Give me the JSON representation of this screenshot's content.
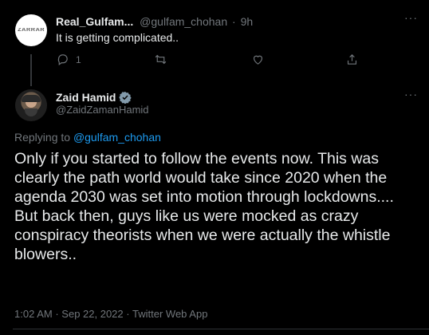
{
  "reply_tweet": {
    "display_name": "Real_Gulfam...",
    "handle": "@gulfam_chohan",
    "separator": "·",
    "time": "9h",
    "text": "It is getting complicated..",
    "avatar_text": "ZARRAR",
    "more_label": "···",
    "reply_count": "1"
  },
  "main_tweet": {
    "display_name": "Zaid Hamid",
    "handle": "@ZaidZamanHamid",
    "more_label": "···",
    "replying_prefix": "Replying to ",
    "replying_handle": "@gulfam_chohan",
    "body_line1": "Only if you started to follow the events now. This was clearly the path world would take since 2020 when the agenda 2030 was set into motion through lockdowns....",
    "body_line2": "But back then, guys like us were mocked as crazy conspiracy theorists when we were actually the whistle blowers..",
    "time": "1:02 AM",
    "date": "Sep 22, 2022",
    "source": "Twitter Web App",
    "separator": "·"
  },
  "colors": {
    "background": "#000000",
    "text_primary": "#e7e9ea",
    "text_secondary": "#71767b",
    "link": "#1d9bf0",
    "verified_badge": "#829aab"
  },
  "icons": [
    "reply-icon",
    "retweet-icon",
    "like-icon",
    "share-icon",
    "verified-badge-icon",
    "more-icon"
  ]
}
